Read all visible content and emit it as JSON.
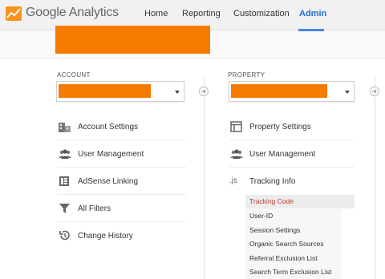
{
  "topbar": {
    "brand": "Google Analytics",
    "nav": [
      {
        "label": "Home",
        "active": false
      },
      {
        "label": "Reporting",
        "active": false
      },
      {
        "label": "Customization",
        "active": false
      },
      {
        "label": "Admin",
        "active": true
      }
    ]
  },
  "account": {
    "label": "ACCOUNT",
    "items": [
      {
        "label": "Account Settings",
        "icon": "building-icon"
      },
      {
        "label": "User Management",
        "icon": "users-icon"
      },
      {
        "label": "AdSense Linking",
        "icon": "adsense-icon"
      },
      {
        "label": "All Filters",
        "icon": "filter-icon"
      },
      {
        "label": "Change History",
        "icon": "history-icon"
      }
    ]
  },
  "property": {
    "label": "PROPERTY",
    "items": [
      {
        "label": "Property Settings",
        "icon": "property-settings-icon"
      },
      {
        "label": "User Management",
        "icon": "users-icon"
      },
      {
        "label": "Tracking Info",
        "icon": "js-icon",
        "icon_text": ".js"
      }
    ],
    "tracking_subitems": [
      {
        "label": "Tracking Code",
        "active": true
      },
      {
        "label": "User-ID",
        "active": false
      },
      {
        "label": "Session Settings",
        "active": false
      },
      {
        "label": "Organic Search Sources",
        "active": false
      },
      {
        "label": "Referral Exclusion List",
        "active": false
      },
      {
        "label": "Search Term Exclusion List",
        "active": false
      }
    ]
  },
  "colors": {
    "accent": "#1f6fd8",
    "redaction": "#f47b00",
    "active_subitem": "#c0392b"
  }
}
